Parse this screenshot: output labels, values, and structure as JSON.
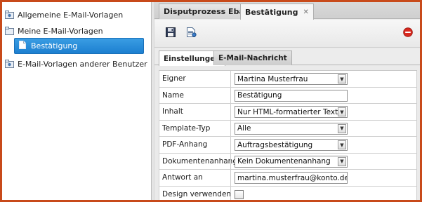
{
  "sidebar": {
    "items": [
      {
        "label": "Allgemeine E-Mail-Vorlagen",
        "icon": "folder-icon"
      },
      {
        "label": "Meine E-Mail-Vorlagen",
        "icon": "folder-icon"
      },
      {
        "label": "Bestätigung",
        "icon": "document-icon",
        "selected": true
      },
      {
        "label": "E-Mail-Vorlagen anderer Benutzer",
        "icon": "folder-icon"
      }
    ]
  },
  "tabs": [
    {
      "label": "Disputprozess Ebay",
      "close": "✕"
    },
    {
      "label": "Bestätigung",
      "close": "✕",
      "active": true
    }
  ],
  "toolbar": {
    "icons": [
      "save-icon",
      "preview-icon",
      "delete-icon"
    ]
  },
  "subtabs": [
    {
      "label": "Einstellungen",
      "active": true
    },
    {
      "label": "E-Mail-Nachricht"
    }
  ],
  "form": {
    "owner": {
      "label": "Eigner",
      "value": "Martina Musterfrau"
    },
    "name": {
      "label": "Name",
      "value": "Bestätigung"
    },
    "content": {
      "label": "Inhalt",
      "value": "Nur HTML-formatierter Text"
    },
    "template_type": {
      "label": "Template-Typ",
      "value": "Alle"
    },
    "pdf_attachment": {
      "label": "PDF-Anhang",
      "value": "Auftragsbestätigung"
    },
    "document_attachment": {
      "label": "Dokumentenanhang",
      "value": "Kein Dokumentenanhang"
    },
    "reply_to": {
      "label": "Antwort an",
      "value": "martina.musterfrau@konto.de"
    },
    "use_design": {
      "label": "Design verwenden",
      "checked": false
    }
  },
  "colors": {
    "accent": "#1c7fd0",
    "border_frame": "#c84a1a",
    "delete": "#d9281e"
  }
}
